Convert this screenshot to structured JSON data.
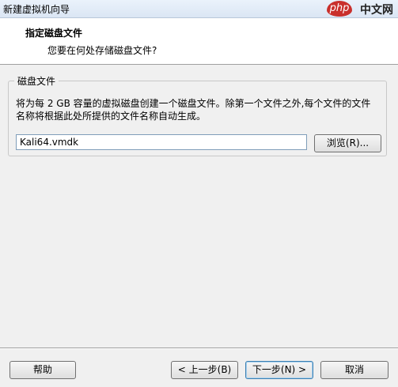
{
  "window": {
    "title": "新建虚拟机向导"
  },
  "watermark": {
    "logo_text": "php",
    "site_text": "中文网"
  },
  "header": {
    "title": "指定磁盘文件",
    "subtitle": "您要在何处存储磁盘文件?"
  },
  "disk_group": {
    "legend": "磁盘文件",
    "description": "将为每 2 GB 容量的虚拟磁盘创建一个磁盘文件。除第一个文件之外,每个文件的文件名称将根据此处所提供的文件名称自动生成。",
    "path_value": "Kali64.vmdk",
    "browse_label": "浏览(R)..."
  },
  "footer": {
    "help_label": "帮助",
    "back_label": "< 上一步(B)",
    "next_label": "下一步(N) >",
    "cancel_label": "取消"
  }
}
